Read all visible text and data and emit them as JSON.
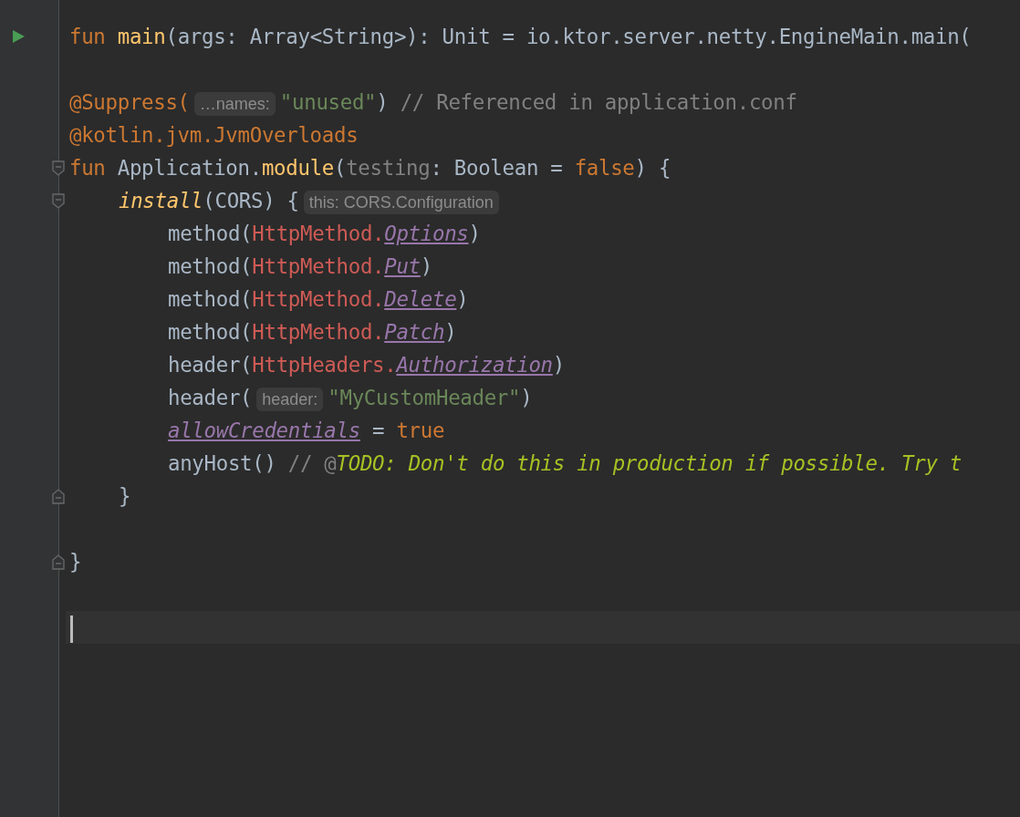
{
  "editor": {
    "lines": [
      {
        "kind": "runnable",
        "tokens": [
          {
            "kind": "keyword",
            "text": "fun "
          },
          {
            "kind": "function",
            "text": "main"
          },
          {
            "kind": "plain",
            "text": "(args: Array<String>): Unit = io.ktor.server.netty.EngineMain.main("
          }
        ]
      },
      {
        "blank_before": true,
        "tokens": [
          {
            "kind": "annotation",
            "text": "@Suppress("
          },
          {
            "kind": "hint",
            "text": "…names:"
          },
          {
            "kind": "string",
            "text": "\"unused\""
          },
          {
            "kind": "plain",
            "text": ") "
          },
          {
            "kind": "comment",
            "text": "// Referenced in application.conf"
          }
        ]
      },
      {
        "tokens": [
          {
            "kind": "annotation",
            "text": "@kotlin.jvm.JvmOverloads"
          }
        ]
      },
      {
        "kind": "fold-start",
        "tokens": [
          {
            "kind": "keyword",
            "text": "fun "
          },
          {
            "kind": "plain",
            "text": "Application."
          },
          {
            "kind": "function",
            "text": "module"
          },
          {
            "kind": "plain",
            "text": "("
          },
          {
            "kind": "parameter",
            "text": "testing"
          },
          {
            "kind": "plain",
            "text": ": Boolean = "
          },
          {
            "kind": "keyword",
            "text": "false"
          },
          {
            "kind": "plain",
            "text": ") {"
          }
        ],
        "children": [
          {
            "kind": "fold-start",
            "tokens": [
              {
                "kind": "call",
                "text": "install"
              },
              {
                "kind": "plain",
                "text": "(CORS) {"
              },
              {
                "kind": "hint",
                "text": "this: CORS.Configuration"
              }
            ],
            "children": [
              {
                "tokens": [
                  {
                    "kind": "plain",
                    "text": "method("
                  },
                  {
                    "kind": "class",
                    "text": "HttpMethod."
                  },
                  {
                    "kind": "property",
                    "text": "Options"
                  },
                  {
                    "kind": "plain",
                    "text": ")"
                  }
                ]
              },
              {
                "tokens": [
                  {
                    "kind": "plain",
                    "text": "method("
                  },
                  {
                    "kind": "class",
                    "text": "HttpMethod."
                  },
                  {
                    "kind": "property",
                    "text": "Put"
                  },
                  {
                    "kind": "plain",
                    "text": ")"
                  }
                ]
              },
              {
                "tokens": [
                  {
                    "kind": "plain",
                    "text": "method("
                  },
                  {
                    "kind": "class",
                    "text": "HttpMethod."
                  },
                  {
                    "kind": "property",
                    "text": "Delete"
                  },
                  {
                    "kind": "plain",
                    "text": ")"
                  }
                ]
              },
              {
                "tokens": [
                  {
                    "kind": "plain",
                    "text": "method("
                  },
                  {
                    "kind": "class",
                    "text": "HttpMethod."
                  },
                  {
                    "kind": "property",
                    "text": "Patch"
                  },
                  {
                    "kind": "plain",
                    "text": ")"
                  }
                ]
              },
              {
                "tokens": [
                  {
                    "kind": "plain",
                    "text": "header("
                  },
                  {
                    "kind": "class",
                    "text": "HttpHeaders."
                  },
                  {
                    "kind": "property",
                    "text": "Authorization"
                  },
                  {
                    "kind": "plain",
                    "text": ")"
                  }
                ]
              },
              {
                "tokens": [
                  {
                    "kind": "plain",
                    "text": "header("
                  },
                  {
                    "kind": "hint",
                    "text": "header:"
                  },
                  {
                    "kind": "string",
                    "text": "\"MyCustomHeader\""
                  },
                  {
                    "kind": "plain",
                    "text": ")"
                  }
                ]
              },
              {
                "tokens": [
                  {
                    "kind": "property",
                    "text": "allowCredentials"
                  },
                  {
                    "kind": "plain",
                    "text": " = "
                  },
                  {
                    "kind": "keyword",
                    "text": "true"
                  }
                ]
              },
              {
                "tokens": [
                  {
                    "kind": "plain",
                    "text": "anyHost() "
                  },
                  {
                    "kind": "comment",
                    "text": "// @"
                  },
                  {
                    "kind": "todo",
                    "text": "TODO: Don't do this in production if possible. Try t"
                  }
                ]
              }
            ]
          },
          {
            "kind": "fold-end",
            "tokens": [
              {
                "kind": "plain",
                "text": "}"
              }
            ]
          }
        ]
      },
      {
        "kind": "fold-end",
        "blank_before": true,
        "tokens": [
          {
            "kind": "plain",
            "text": "}"
          }
        ]
      },
      {
        "kind": "current",
        "blank_before": true
      }
    ]
  }
}
